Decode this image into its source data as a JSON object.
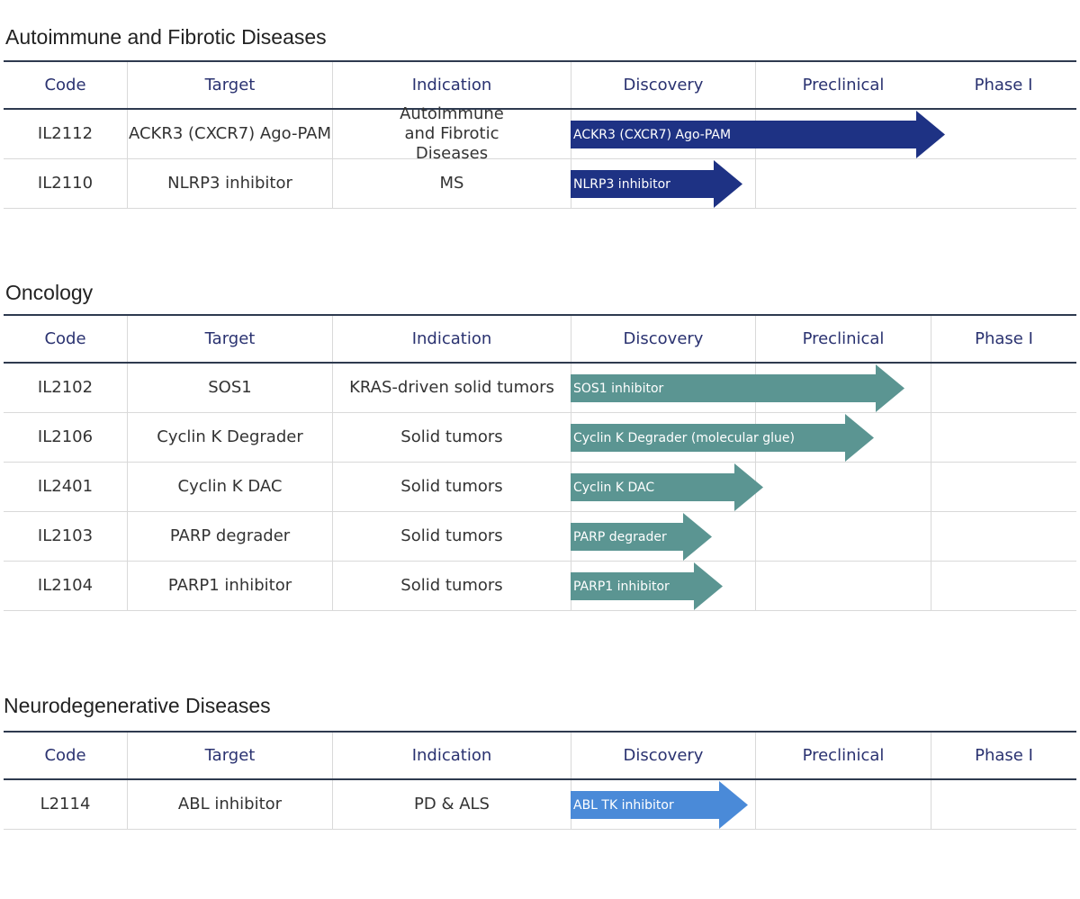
{
  "colors": {
    "autoimmune_arrow": "#1e3284",
    "oncology_arrow": "#5b9592",
    "neuro_arrow": "#4a8ad8",
    "header_text": "#2a3270"
  },
  "columns": {
    "code": "Code",
    "target": "Target",
    "indication": "Indication",
    "discovery": "Discovery",
    "preclinical": "Preclinical",
    "phase1": "Phase I"
  },
  "sections": [
    {
      "title": "Autoimmune and Fibrotic Diseases",
      "rows": [
        {
          "code": "IL2112",
          "target": "ACKR3 (CXCR7) Ago-PAM",
          "indication": "Autoimmune and Fibrotic Diseases",
          "bar_label": "ACKR3 (CXCR7) Ago-PAM",
          "progress": 0.74
        },
        {
          "code": "IL2110",
          "target": "NLRP3 inhibitor",
          "indication": "MS",
          "bar_label": "NLRP3 inhibitor",
          "progress": 0.34
        }
      ]
    },
    {
      "title": "Oncology",
      "rows": [
        {
          "code": "IL2102",
          "target": "SOS1",
          "indication": "KRAS-driven solid tumors",
          "bar_label": "SOS1 inhibitor",
          "progress": 0.66
        },
        {
          "code": "IL2106",
          "target": "Cyclin K Degrader",
          "indication": "Solid tumors",
          "bar_label": "Cyclin K Degrader (molecular glue)",
          "progress": 0.6
        },
        {
          "code": "IL2401",
          "target": "Cyclin K DAC",
          "indication": "Solid tumors",
          "bar_label": "Cyclin K DAC",
          "progress": 0.38
        },
        {
          "code": "IL2103",
          "target": "PARP degrader",
          "indication": "Solid tumors",
          "bar_label": "PARP degrader",
          "progress": 0.28
        },
        {
          "code": "IL2104",
          "target": "PARP1 inhibitor",
          "indication": "Solid tumors",
          "bar_label": "PARP1 inhibitor",
          "progress": 0.3
        }
      ]
    },
    {
      "title": "Neurodegenerative Diseases",
      "rows": [
        {
          "code": "L2114",
          "target": "ABL inhibitor",
          "indication": "PD & ALS",
          "bar_label": "ABL TK inhibitor",
          "progress": 0.35
        }
      ]
    }
  ]
}
